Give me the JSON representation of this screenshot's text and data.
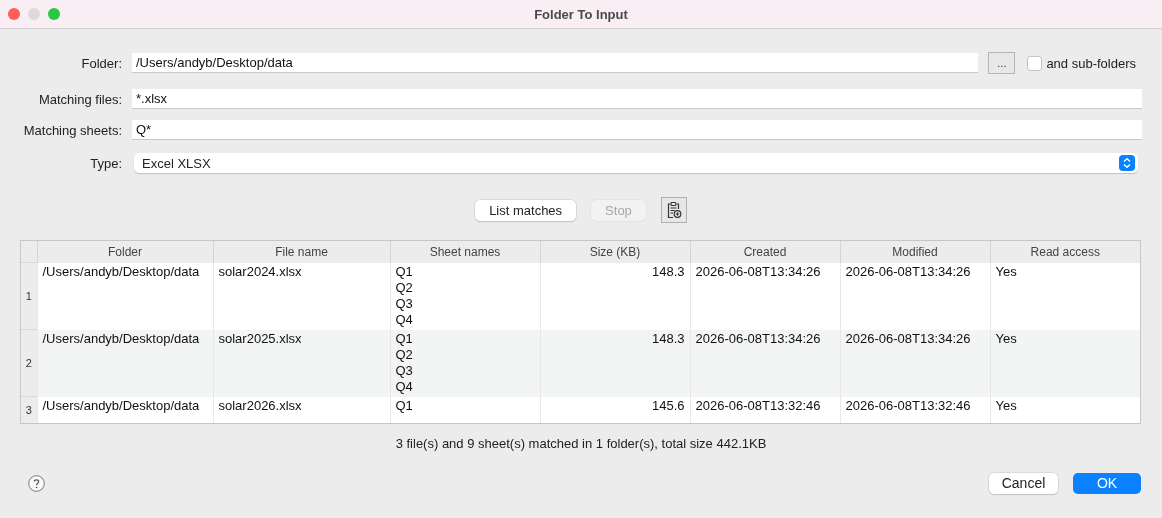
{
  "window": {
    "title": "Folder To Input"
  },
  "form": {
    "folder": {
      "label": "Folder:",
      "value": "/Users/andyb/Desktop/data",
      "browse": "...",
      "subfolders": {
        "label": "and sub-folders",
        "checked": false
      }
    },
    "matching_files": {
      "label": "Matching files:",
      "value": "*.xlsx"
    },
    "matching_sheets": {
      "label": "Matching sheets:",
      "value": "Q*"
    },
    "type": {
      "label": "Type:",
      "value": "Excel XLSX"
    }
  },
  "actions": [
    {
      "kind": "button",
      "label": "List matches",
      "disabled": false
    },
    {
      "kind": "button",
      "label": "Stop",
      "disabled": true
    },
    {
      "kind": "icon"
    }
  ],
  "table": {
    "columns": [
      "Folder",
      "File name",
      "Sheet names",
      "Size (KB)",
      "Created",
      "Modified",
      "Read access"
    ],
    "rows": [
      {
        "number": "1",
        "cells": [
          "/Users/andyb/Desktop/data",
          "solar2024.xlsx",
          [
            "Q1",
            "Q2",
            "Q3",
            "Q4"
          ],
          "148.3",
          "2026-06-08T13:34:26",
          "2026-06-08T13:34:26",
          "Yes"
        ]
      },
      {
        "number": "2",
        "cells": [
          "/Users/andyb/Desktop/data",
          "solar2025.xlsx",
          [
            "Q1",
            "Q2",
            "Q3",
            "Q4"
          ],
          "148.3",
          "2026-06-08T13:34:26",
          "2026-06-08T13:34:26",
          "Yes"
        ]
      },
      {
        "number": "3",
        "cells": [
          "/Users/andyb/Desktop/data",
          "solar2026.xlsx",
          [
            "Q1"
          ],
          "145.6",
          "2026-06-08T13:32:46",
          "2026-06-08T13:32:46",
          "Yes"
        ]
      }
    ]
  },
  "summary": "3 file(s) and 9 sheet(s) matched in 1 folder(s), total size 442.1KB",
  "buttons": [
    {
      "label": "Cancel",
      "default": false
    },
    {
      "label": "OK",
      "default": true
    }
  ]
}
